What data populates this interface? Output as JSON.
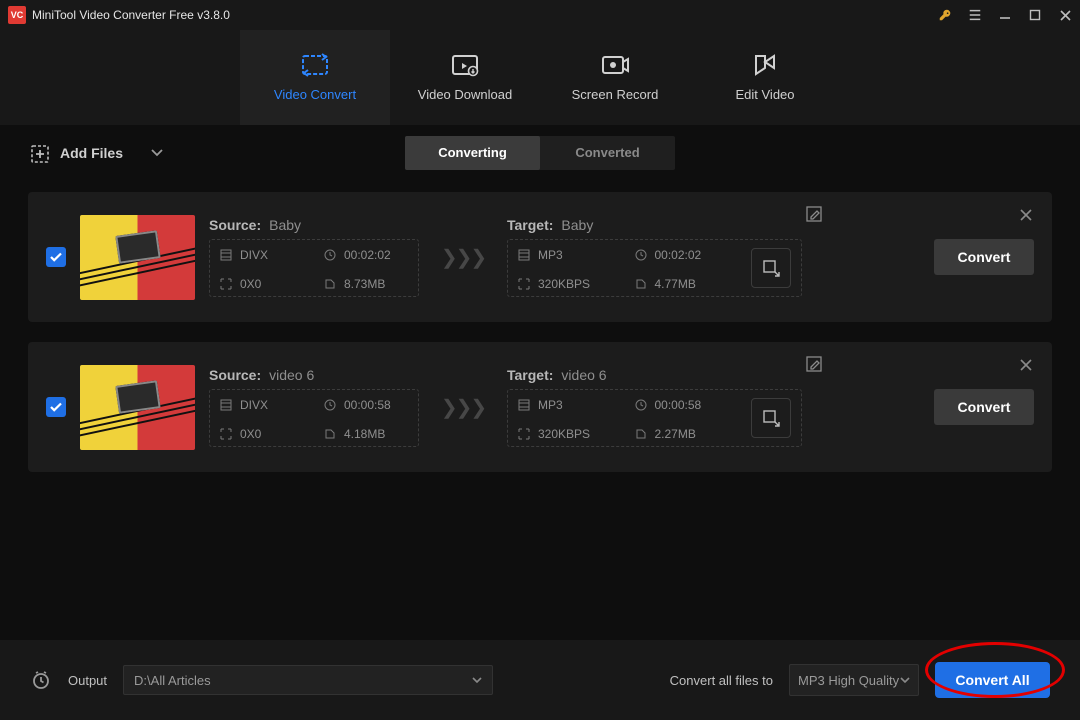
{
  "titlebar": {
    "app_title": "MiniTool Video Converter Free v3.8.0"
  },
  "nav": {
    "tabs": [
      {
        "label": "Video Convert",
        "active": true
      },
      {
        "label": "Video Download",
        "active": false
      },
      {
        "label": "Screen Record",
        "active": false
      },
      {
        "label": "Edit Video",
        "active": false
      }
    ]
  },
  "toolbar": {
    "add_files_label": "Add Files",
    "segmented": {
      "converting": "Converting",
      "converted": "Converted",
      "active": "converting"
    }
  },
  "items": [
    {
      "source": {
        "name": "Baby",
        "format": "DIVX",
        "duration": "00:02:02",
        "resolution": "0X0",
        "size": "8.73MB"
      },
      "target": {
        "name": "Baby",
        "format": "MP3",
        "duration": "00:02:02",
        "bitrate": "320KBPS",
        "size": "4.77MB"
      },
      "convert_label": "Convert"
    },
    {
      "source": {
        "name": "video 6",
        "format": "DIVX",
        "duration": "00:00:58",
        "resolution": "0X0",
        "size": "4.18MB"
      },
      "target": {
        "name": "video 6",
        "format": "MP3",
        "duration": "00:00:58",
        "bitrate": "320KBPS",
        "size": "2.27MB"
      },
      "convert_label": "Convert"
    }
  ],
  "labels": {
    "source": "Source:",
    "target": "Target:"
  },
  "bottom": {
    "output_label": "Output",
    "output_path": "D:\\All Articles",
    "convert_all_label": "Convert all files to",
    "format_selected": "MP3 High Quality",
    "convert_all_button": "Convert All"
  }
}
